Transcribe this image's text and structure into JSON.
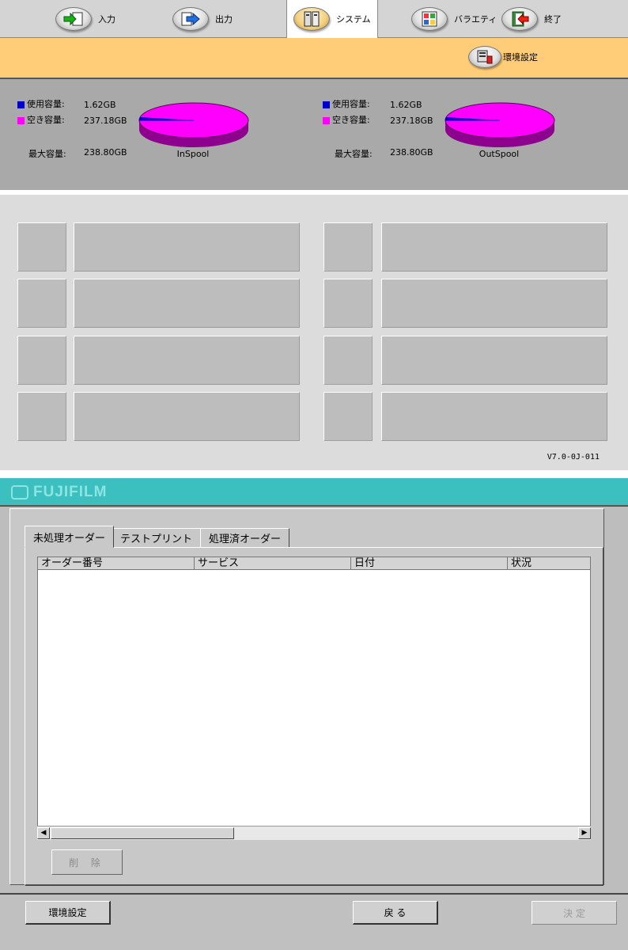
{
  "nav": {
    "items": [
      {
        "label": "入力",
        "icon": "input-arrow-icon"
      },
      {
        "label": "出力",
        "icon": "output-arrow-icon"
      },
      {
        "label": "システム",
        "icon": "system-icon"
      },
      {
        "label": "バラエティ",
        "icon": "variety-icon"
      },
      {
        "label": "終了",
        "icon": "exit-icon"
      }
    ],
    "active": "システム"
  },
  "subbar": {
    "env_label": "環境設定",
    "env_icon": "wrench-settings-icon"
  },
  "spool": {
    "legend_used": "使用容量:",
    "legend_free": "空き容量:",
    "legend_max": "最大容量:",
    "colors": {
      "used": "#0000cc",
      "free": "#ff00ff"
    },
    "in": {
      "used": "1.62GB",
      "free": "237.18GB",
      "max": "238.80GB",
      "caption": "InSpool"
    },
    "out": {
      "used": "1.62GB",
      "free": "237.18GB",
      "max": "238.80GB",
      "caption": "OutSpool"
    }
  },
  "version": "V7.0-0J-011",
  "brand": "FUJIFILM",
  "dialog": {
    "tabs": [
      "未処理オーダー",
      "テストプリント",
      "処理済オーダー"
    ],
    "columns": [
      "オーダー番号",
      "サービス",
      "日付",
      "状況"
    ],
    "delete_label": "削 除"
  },
  "footer": {
    "env_button": "環境設定",
    "back_button": "戻 る",
    "ok_button": "決 定"
  }
}
